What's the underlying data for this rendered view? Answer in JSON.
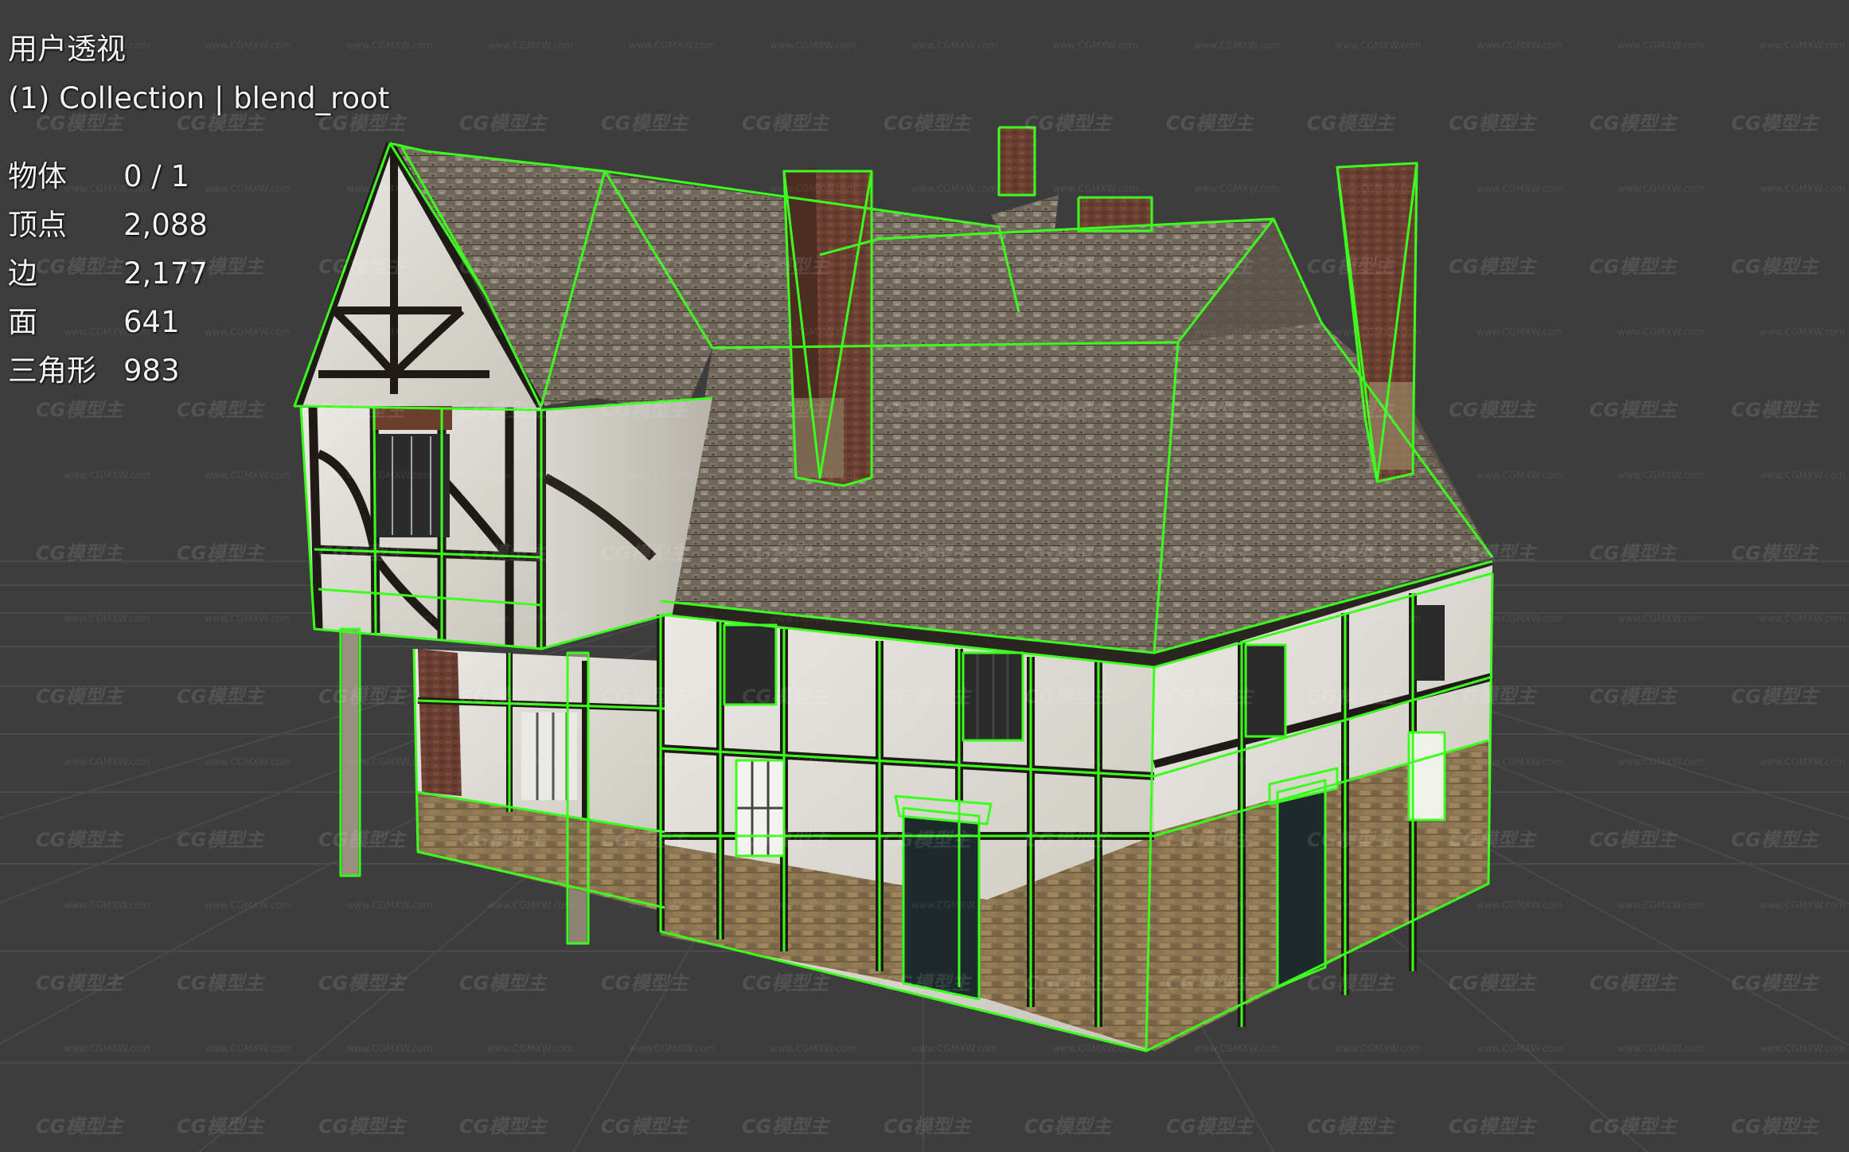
{
  "viewport": {
    "view_name": "用户透视",
    "collection_line": "(1) Collection | blend_root",
    "stats": [
      {
        "label": "物体",
        "value": "0 / 1"
      },
      {
        "label": "顶点",
        "value": "2,088"
      },
      {
        "label": "边",
        "value": "2,177"
      },
      {
        "label": "面",
        "value": "641"
      },
      {
        "label": "三角形",
        "value": "983"
      }
    ],
    "watermark_logo": "CG模型主",
    "watermark_url": "www.CGMXW.com"
  },
  "colors": {
    "background": "#3d3d3d",
    "grid": "#4a4a4a",
    "wireframe": "#3cff1e",
    "text": "#f2f2f2"
  }
}
